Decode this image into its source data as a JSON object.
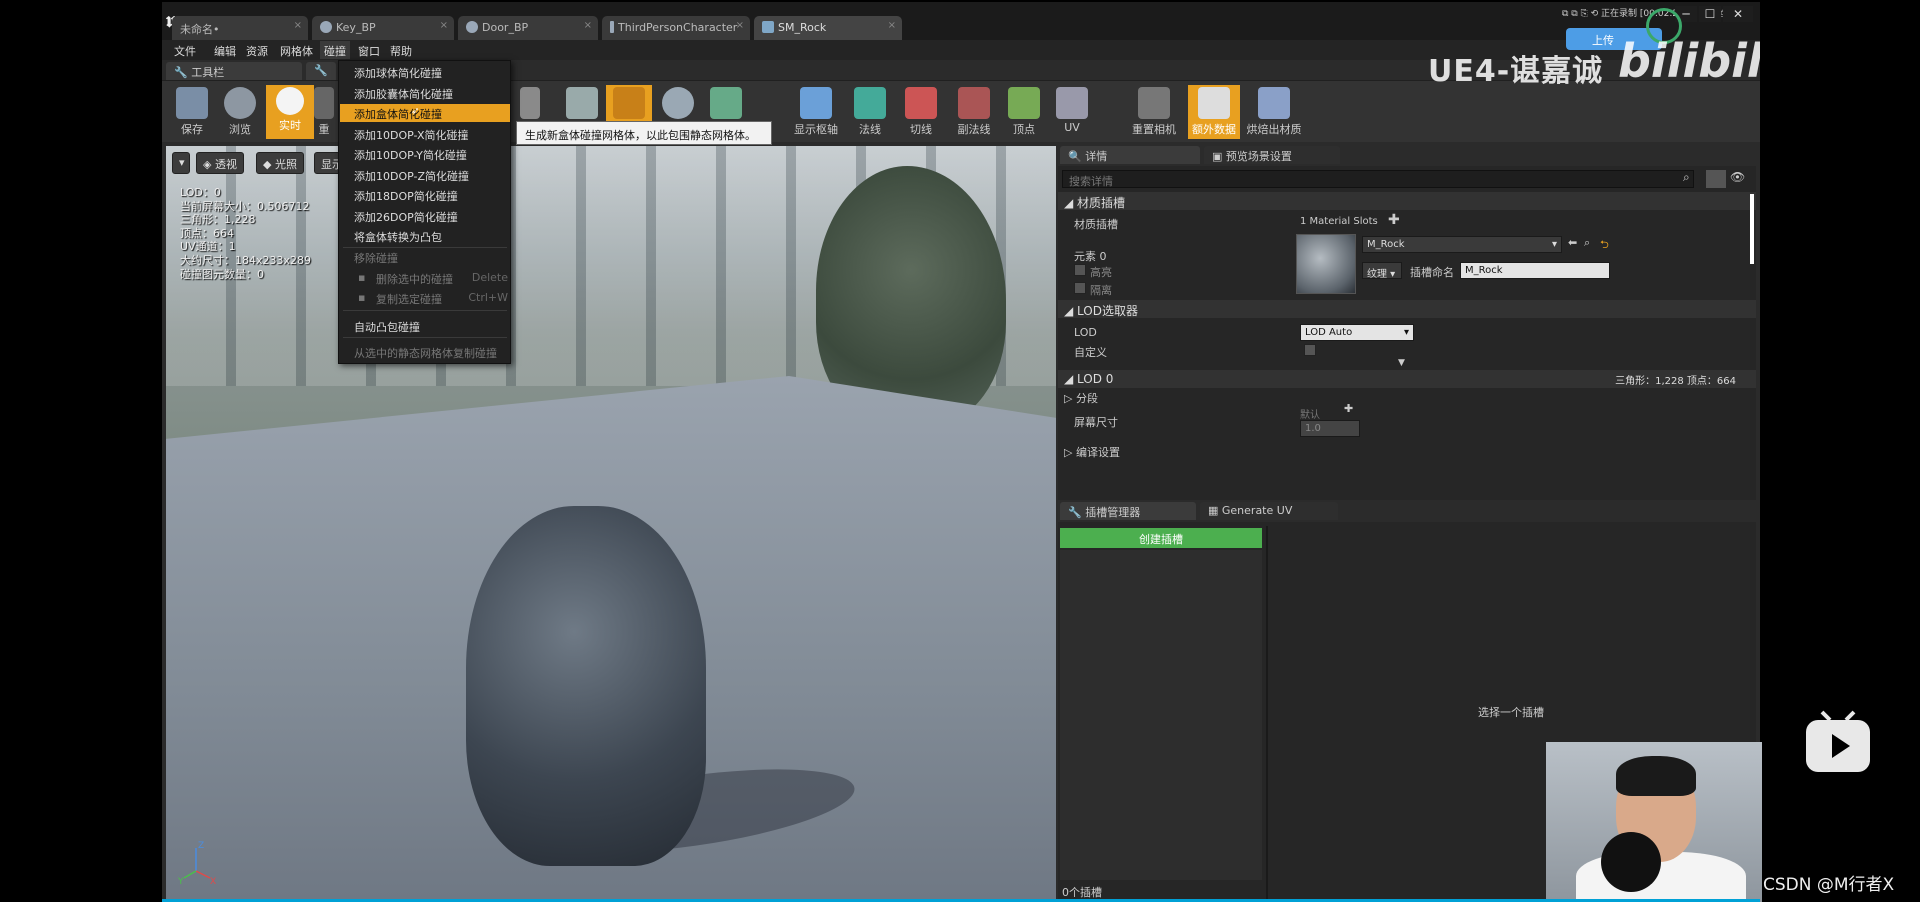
{
  "tabs": [
    {
      "label": "未命名•",
      "active": false
    },
    {
      "label": "Key_BP",
      "active": false
    },
    {
      "label": "Door_BP",
      "active": false
    },
    {
      "label": "ThirdPersonCharacter",
      "active": false
    },
    {
      "label": "SM_Rock",
      "active": true
    }
  ],
  "menu": [
    "文件",
    "编辑",
    "资源",
    "网格体",
    "碰撞",
    "窗口",
    "帮助"
  ],
  "toolbar_panel_tab": "工具栏",
  "toolbar": {
    "save": "保存",
    "browse": "浏览",
    "realtime": "实时",
    "reimport_truncated": "重",
    "show_pivot": "显示枢轴",
    "normals": "法线",
    "tangents": "切线",
    "binormals": "副法线",
    "vertices": "顶点",
    "uv": "UV",
    "reset_camera": "重置相机",
    "additional_data": "额外数据",
    "bake_materials": "烘焙出材质"
  },
  "collision_menu": {
    "items": [
      {
        "label": "添加球体简化碰撞",
        "state": "normal"
      },
      {
        "label": "添加胶囊体简化碰撞",
        "state": "normal"
      },
      {
        "label": "添加盒体简化碰撞",
        "state": "highlighted"
      },
      {
        "label": "添加10DOP-X简化碰撞",
        "state": "normal"
      },
      {
        "label": "添加10DOP-Y简化碰撞",
        "state": "normal"
      },
      {
        "label": "添加10DOP-Z简化碰撞",
        "state": "normal"
      },
      {
        "label": "添加18DOP简化碰撞",
        "state": "normal"
      },
      {
        "label": "添加26DOP简化碰撞",
        "state": "normal"
      },
      {
        "label": "将盒体转换为凸包",
        "state": "normal"
      },
      {
        "label": "移除碰撞",
        "state": "disabled"
      },
      {
        "label": "删除选中的碰撞",
        "state": "disabled",
        "shortcut": "Delete"
      },
      {
        "label": "复制选定碰撞",
        "state": "disabled",
        "shortcut": "Ctrl+W"
      },
      {
        "label": "自动凸包碰撞",
        "state": "normal"
      },
      {
        "label": "从选中的静态网格体复制碰撞",
        "state": "disabled"
      }
    ],
    "tooltip": "生成新盒体碰撞网格体，以此包围静态网格体。"
  },
  "viewport": {
    "buttons": [
      "透视",
      "光照",
      "显示"
    ],
    "stats": [
      "LOD：0",
      "当前屏幕大小：0.506712",
      "三角形：1,228",
      "顶点：664",
      "UV通道：1",
      "大约尺寸：184x233x289",
      "碰撞图元数量：0"
    ],
    "axes": {
      "x": "X",
      "y": "Y",
      "z": "Z"
    }
  },
  "details": {
    "tab_details": "详情",
    "tab_preview": "预览场景设置",
    "search_placeholder": "搜索详情",
    "material_section": "材质插槽",
    "material_slots_label": "材质插槽",
    "material_slots_value": "1 Material Slots",
    "element0": "元素 0",
    "highlight": "高亮",
    "isolate": "隔离",
    "material_name": "M_Rock",
    "texture_btn": "纹理",
    "slot_name_label": "插槽命名",
    "slot_name_value": "M_Rock",
    "lod_picker_section": "LOD选取器",
    "lod_label": "LOD",
    "lod_value": "LOD Auto",
    "custom_label": "自定义",
    "lod0_section": "LOD 0",
    "lod0_info": "三角形：1,228   顶点：664",
    "sections": "分段",
    "screen_size": "屏幕尺寸",
    "default": "默认",
    "screen_size_value": "1.0",
    "build_settings": "编译设置"
  },
  "socket_panel": {
    "tab_socket": "插槽管理器",
    "tab_uv": "Generate UV",
    "create_button": "创建插槽",
    "select_hint": "选择一个插槽",
    "count": "0个插槽"
  },
  "overlay": {
    "watermark_title": "UE4-谌嘉诚",
    "bilibili_logo": "bilibili",
    "upload_label": "上传",
    "recording": "正在录制 [00:02:25]",
    "csdn": "CSDN @M行者X"
  },
  "colors": {
    "accent": "#e8a020",
    "green_button": "#4caf4f",
    "panel": "#262626"
  }
}
